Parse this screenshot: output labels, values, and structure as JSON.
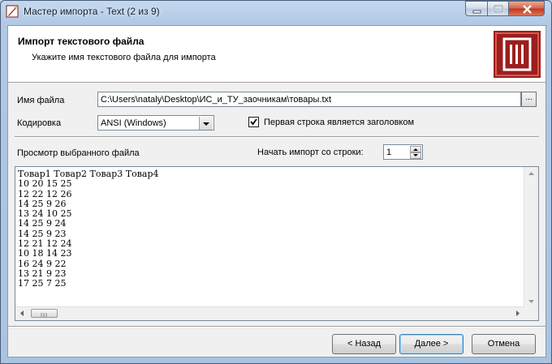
{
  "window": {
    "title": "Мастер импорта - Text (2 из 9)"
  },
  "header": {
    "title": "Импорт текстового файла",
    "subtitle": "Укажите имя текстового файла для импорта"
  },
  "form": {
    "file_label": "Имя файла",
    "file_value": "C:\\Users\\nataly\\Desktop\\ИС_и_ТУ_заочникам\\товары.txt",
    "browse_label": "...",
    "encoding_label": "Кодировка",
    "encoding_value": "ANSI (Windows)",
    "header_checkbox_label": "Первая строка является заголовком",
    "header_checkbox_checked": true,
    "preview_label": "Просмотр выбранного файла",
    "start_row_label": "Начать импорт со строки:",
    "start_row_value": "1"
  },
  "preview": {
    "lines": [
      "Товар1 Товар2 Товар3 Товар4",
      "10 20 15 25",
      "12 22 12 26",
      "14 25 9 26",
      "13 24 10 25",
      "14 25 9 24",
      "14 25 9 23",
      "12 21 12 24",
      "10 18 14 23",
      "16 24 9 22",
      "13 21 9 23",
      "17 25 7 25"
    ]
  },
  "buttons": {
    "back": "< Назад",
    "next": "Далее >",
    "cancel": "Отмена"
  },
  "colors": {
    "logo_bg": "#9c1e1e",
    "titlebar": "#b9d1ea",
    "close_button": "#c0381f"
  }
}
